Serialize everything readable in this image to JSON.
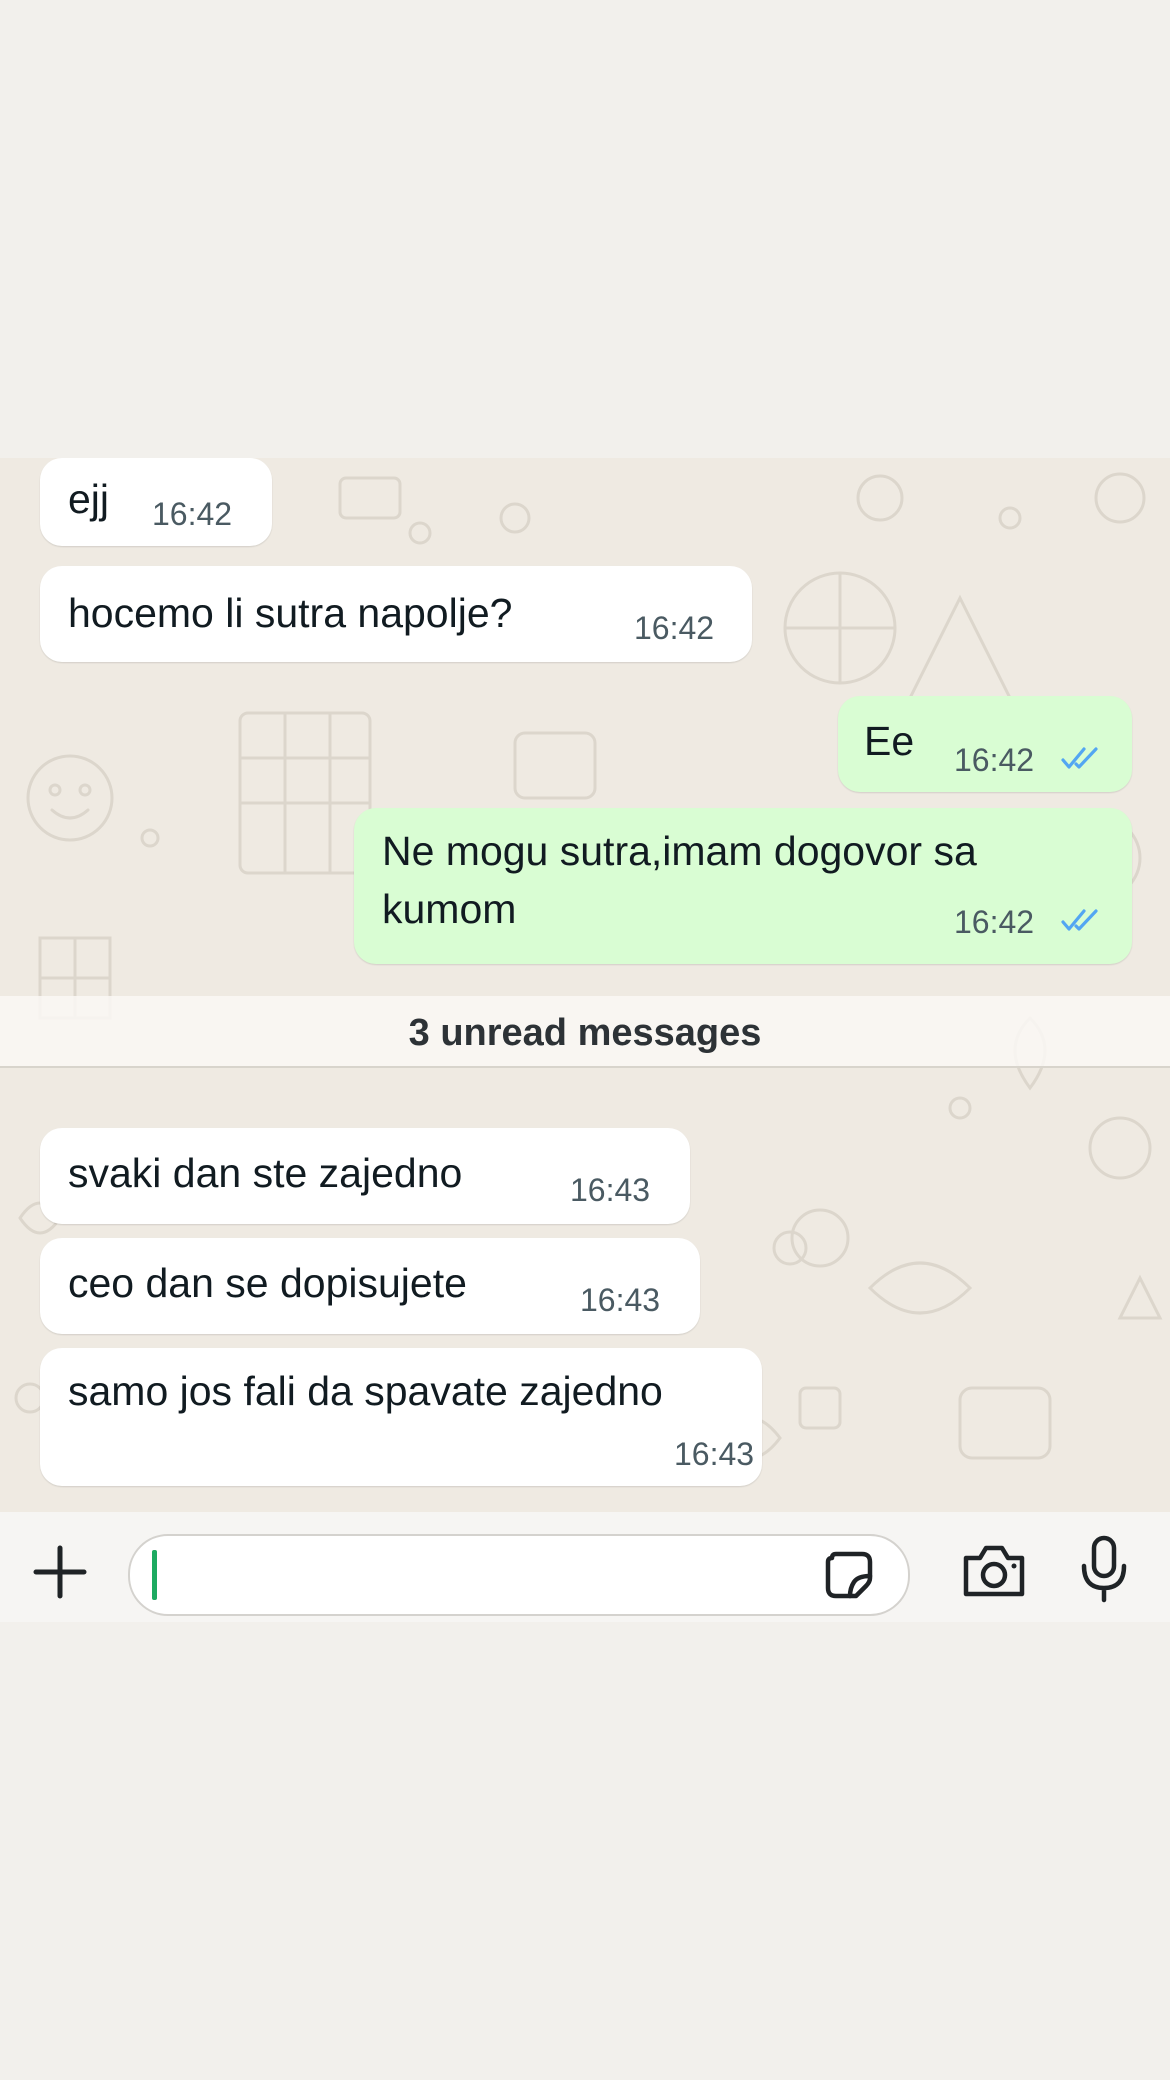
{
  "messages": [
    {
      "direction": "incoming",
      "text": "ejj",
      "time": "16:42"
    },
    {
      "direction": "incoming",
      "text": "hocemo li sutra napolje?",
      "time": "16:42"
    },
    {
      "direction": "outgoing",
      "text": "Ee",
      "time": "16:42",
      "status": "read"
    },
    {
      "direction": "outgoing",
      "lines": [
        "Ne mogu sutra,imam dogovor sa",
        "kumom"
      ],
      "time": "16:42",
      "status": "read"
    },
    {
      "direction": "incoming",
      "text": "svaki dan ste zajedno",
      "time": "16:43"
    },
    {
      "direction": "incoming",
      "text": "ceo dan se dopisujete",
      "time": "16:43"
    },
    {
      "direction": "incoming",
      "text": "samo jos fali da spavate zajedno",
      "time": "16:43"
    }
  ],
  "unread_divider": "3 unread messages",
  "composer": {
    "input_value": "",
    "icons": [
      "plus-icon",
      "sticker-icon",
      "camera-icon",
      "microphone-icon"
    ]
  },
  "colors": {
    "incoming_bubble": "#ffffff",
    "outgoing_bubble": "#d9fdd3",
    "read_ticks": "#53a6f2",
    "caret": "#1daa61"
  }
}
